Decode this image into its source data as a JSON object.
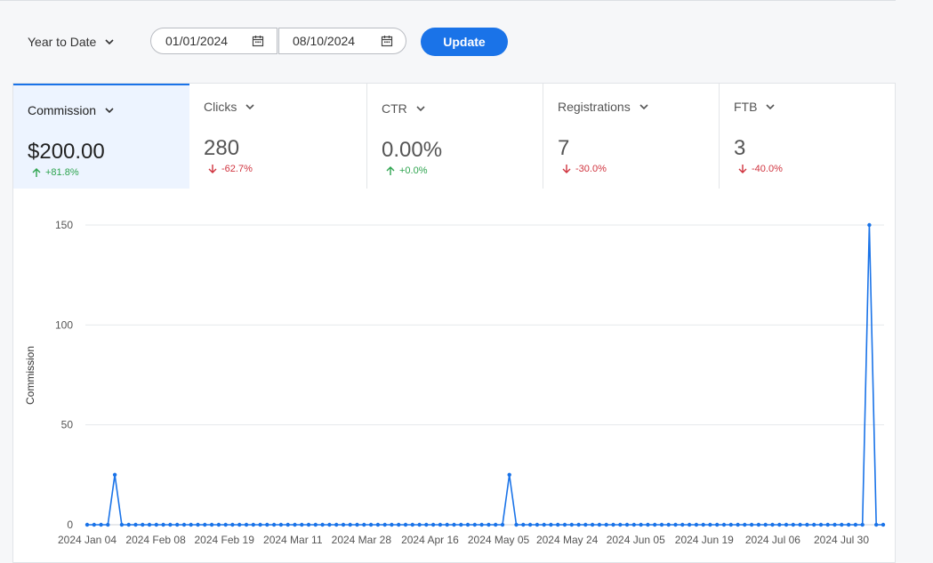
{
  "toolbar": {
    "range_label": "Year to Date",
    "start_date": "01/01/2024",
    "end_date": "08/10/2024",
    "update_label": "Update",
    "accent_color": "#1a73e8"
  },
  "metrics": [
    {
      "label": "Commission",
      "value": "$200.00",
      "delta": "+81.8%",
      "trend": "up",
      "active": true
    },
    {
      "label": "Clicks",
      "value": "280",
      "delta": "-62.7%",
      "trend": "down",
      "active": false
    },
    {
      "label": "CTR",
      "value": "0.00%",
      "delta": "+0.0%",
      "trend": "up",
      "active": false
    },
    {
      "label": "Registrations",
      "value": "7",
      "delta": "-30.0%",
      "trend": "down",
      "active": false
    },
    {
      "label": "FTB",
      "value": "3",
      "delta": "-40.0%",
      "trend": "down",
      "active": false
    }
  ],
  "chart_data": {
    "type": "line",
    "ylabel": "Commission",
    "ylim": [
      0,
      150
    ],
    "y_ticks": [
      0,
      50,
      100,
      150
    ],
    "x_tick_labels": [
      "2024 Jan 04",
      "2024 Feb 08",
      "2024 Feb 19",
      "2024 Mar 11",
      "2024 Mar 28",
      "2024 Apr 16",
      "2024 May 05",
      "2024 May 24",
      "2024 Jun 05",
      "2024 Jun 19",
      "2024 Jul 06",
      "2024 Jul 30"
    ],
    "grid": true,
    "line_color": "#1a73e8",
    "point_count": 116,
    "nonzero_points": [
      {
        "index": 4,
        "value": 25
      },
      {
        "index": 61,
        "value": 25
      },
      {
        "index": 113,
        "value": 150
      }
    ]
  }
}
